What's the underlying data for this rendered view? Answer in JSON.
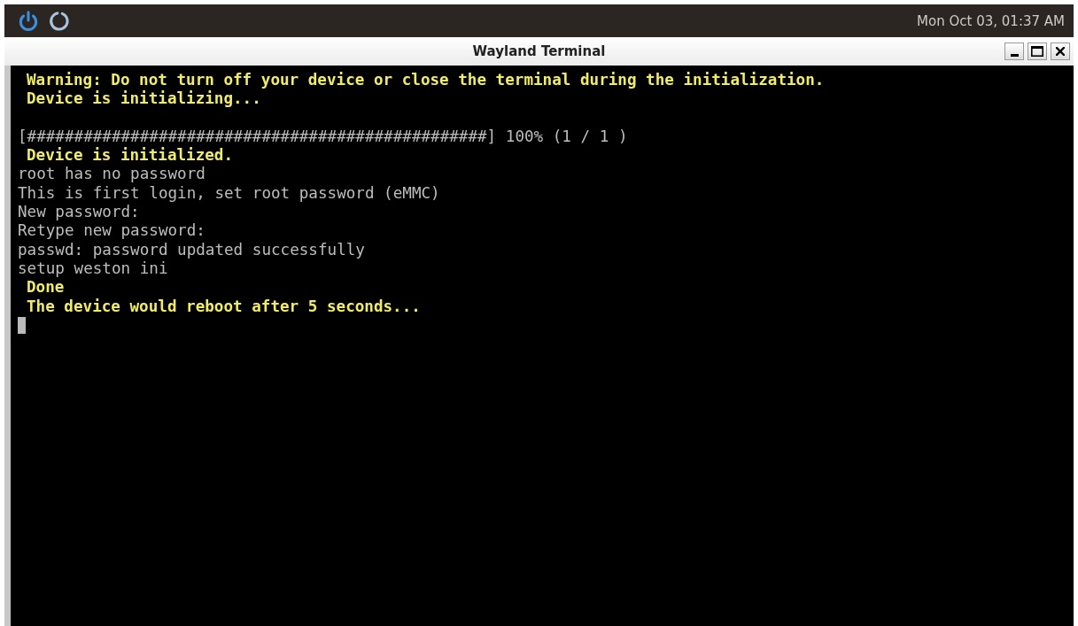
{
  "top_bar": {
    "clock": "Mon Oct 03, 01:37 AM"
  },
  "window": {
    "title": "Wayland Terminal",
    "buttons": [
      {
        "kind": "minimize"
      },
      {
        "kind": "maximize"
      },
      {
        "kind": "close"
      }
    ]
  },
  "terminal": {
    "lines": [
      {
        "kind": "notice",
        "text": "Warning: Do not turn off your device or close the terminal during the initialization."
      },
      {
        "kind": "notice",
        "text": "Device is initializing..."
      },
      {
        "kind": "blank"
      },
      {
        "kind": "output",
        "text": "[#################################################] 100% (1 / 1 )"
      },
      {
        "kind": "notice",
        "text": "Device is initialized."
      },
      {
        "kind": "output",
        "text": "root has no password"
      },
      {
        "kind": "output",
        "text": "This is first login, set root password (eMMC)"
      },
      {
        "kind": "output",
        "text": "New password:"
      },
      {
        "kind": "output",
        "text": "Retype new password:"
      },
      {
        "kind": "output",
        "text": "passwd: password updated successfully"
      },
      {
        "kind": "output",
        "text": "setup weston ini"
      },
      {
        "kind": "notice",
        "text": "Done"
      },
      {
        "kind": "notice",
        "text": "The device would reboot after 5 seconds..."
      }
    ],
    "cursor": true
  }
}
